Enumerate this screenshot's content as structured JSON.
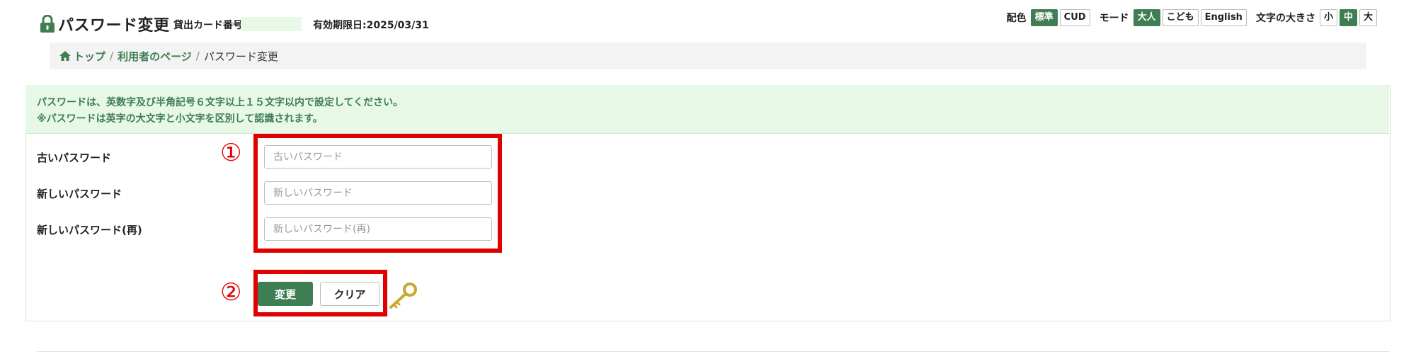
{
  "header": {
    "title": "パスワード変更",
    "card_label": "貸出カード番号:",
    "card_value": "",
    "expiry": "有効期限日:2025/03/31"
  },
  "settings": {
    "color_label": "配色",
    "color_options": [
      "標準",
      "CUD"
    ],
    "color_selected": "標準",
    "mode_label": "モード",
    "mode_options": [
      "大人",
      "こども",
      "English"
    ],
    "mode_selected": "大人",
    "size_label": "文字の大きさ",
    "size_options": [
      "小",
      "中",
      "大"
    ],
    "size_selected": "中"
  },
  "breadcrumb": {
    "home": "トップ",
    "mypage": "利用者のページ",
    "current": "パスワード変更",
    "separator": "/"
  },
  "notice": {
    "line1": "パスワードは、英数字及び半角記号６文字以上１５文字以内で設定してください。",
    "line2": "※パスワードは英字の大文字と小文字を区別して認識されます。"
  },
  "form": {
    "old_label": "古いパスワード",
    "old_placeholder": "古いパスワード",
    "new_label": "新しいパスワード",
    "new_placeholder": "新しいパスワード",
    "confirm_label": "新しいパスワード(再)",
    "confirm_placeholder": "新しいパスワード(再)"
  },
  "buttons": {
    "change": "変更",
    "clear": "クリア"
  },
  "annotations": {
    "one": "①",
    "two": "②"
  },
  "colors": {
    "accent": "#3f7d53",
    "notice_bg": "#e7f8e6",
    "callout": "#e00000"
  },
  "icons": [
    "lock-icon",
    "home-icon",
    "key-icon"
  ]
}
